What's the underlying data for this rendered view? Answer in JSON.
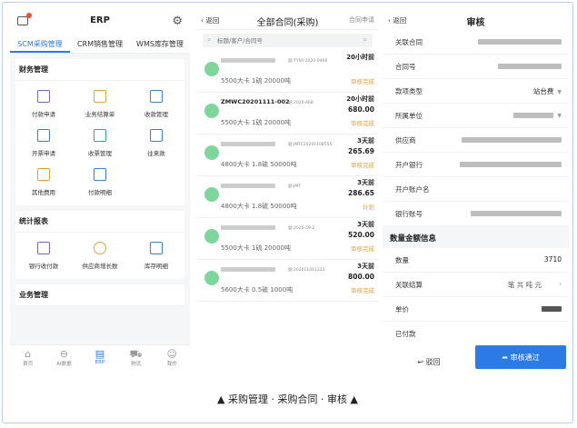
{
  "left": {
    "header_title": "ERP",
    "tabs": [
      "SCM采购管理",
      "CRM销售管理",
      "WMS库存管理"
    ],
    "finance": {
      "title": "财务管理",
      "items": [
        "付款申请",
        "业务结算单",
        "收款管理",
        "开票申请",
        "收票管理",
        "往来款",
        "其他费用",
        "付款明细"
      ]
    },
    "stats": {
      "title": "统计报表",
      "items": [
        "银行收付款",
        "供应商增长数",
        "库存明细"
      ]
    },
    "business_title": "业务管理",
    "nav": [
      "首页",
      "AI数据",
      "ERP",
      "物流",
      "我的"
    ]
  },
  "middle": {
    "back": "返回",
    "title": "全部合同(采购)",
    "apply": "合同申请",
    "search_placeholder": "标题/客户/合同号",
    "rows": [
      {
        "code": "",
        "sub": "副:TYNY-2020-0468",
        "desc": "5500大卡 1硫  20000吨",
        "time": "20小时前",
        "amount": "",
        "status": "审核完成"
      },
      {
        "code": "ZMWC20201111-002",
        "sub": "副:2020-468",
        "desc": "5500大卡 1硫  20000吨",
        "time": "20小时前",
        "amount": "680.00",
        "status": "审核完成"
      },
      {
        "code": "",
        "sub": "副:JMTC20201108555",
        "desc": "4800大卡 1.8硫  50000吨",
        "time": "3天前",
        "amount": "265.69",
        "status": "审核完成"
      },
      {
        "code": "",
        "sub": "副:JMT",
        "desc": "4800大卡 1.8硫  50000吨",
        "time": "3天前",
        "amount": "286.65",
        "status": "计划"
      },
      {
        "code": "",
        "sub": "副:2020-59-2",
        "desc": "5500大卡 1硫  20000吨",
        "time": "3天前",
        "amount": "520.00",
        "status": "审核完成"
      },
      {
        "code": "",
        "sub": "副:202011041323",
        "desc": "5600大卡 0.5硫  1000吨",
        "time": "3天前",
        "amount": "800.00",
        "status": "审核完成"
      }
    ]
  },
  "right": {
    "back": "返回",
    "title": "审核",
    "fields": [
      {
        "label": "关联合同",
        "value": ""
      },
      {
        "label": "合同号",
        "value": ""
      },
      {
        "label": "款项类型",
        "value": "站台费"
      },
      {
        "label": "所属单位",
        "value": ""
      },
      {
        "label": "供应商",
        "value": ""
      },
      {
        "label": "开户银行",
        "value": ""
      },
      {
        "label": "开户账户名",
        "value": ""
      },
      {
        "label": "银行账号",
        "value": ""
      }
    ],
    "section_title": "数量金额信息",
    "amount_fields": [
      {
        "label": "数量",
        "value": "3710"
      },
      {
        "label": "关联结算",
        "value": "笔 共 吨 元"
      },
      {
        "label": "单价",
        "value": ""
      },
      {
        "label": "已付款",
        "value": ""
      }
    ],
    "btn_back": "驳回",
    "btn_ok": "审核通过"
  },
  "caption": "▲ 采购管理 · 采购合同 · 审核 ▲",
  "colors": {
    "accent": "#2c7be5",
    "status": "#e8a03a",
    "avatar": "#7fd69b"
  }
}
